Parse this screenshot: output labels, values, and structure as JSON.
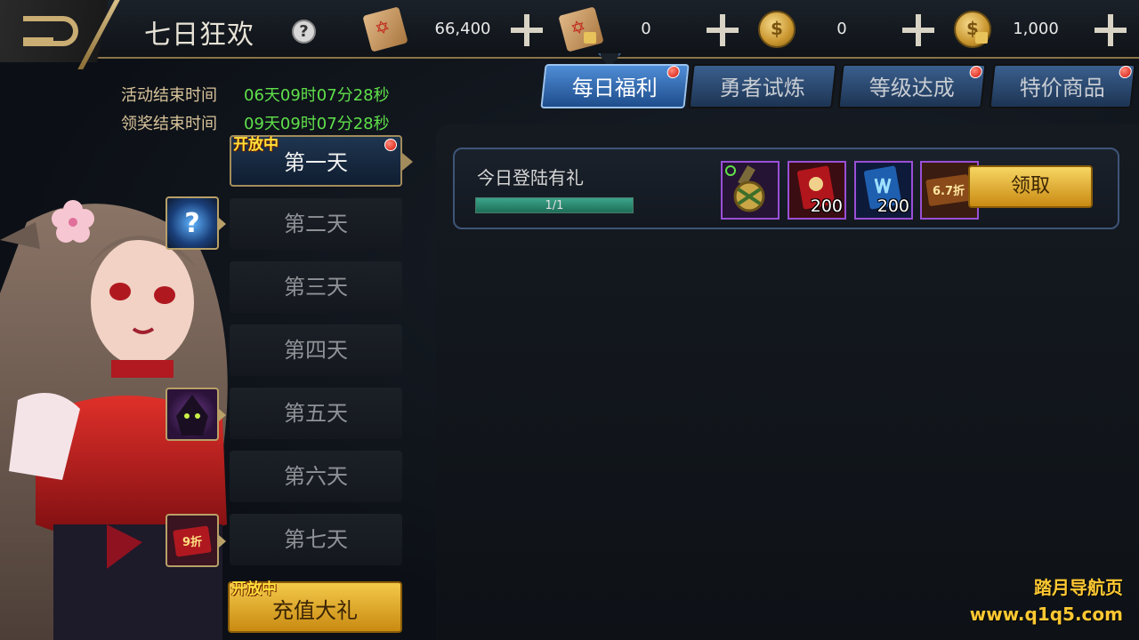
{
  "header": {
    "title": "七日狂欢",
    "help_icon": "question-mark-icon",
    "resources": [
      {
        "name": "scroll",
        "icon": "red-seal-scroll-icon",
        "value": "66,400"
      },
      {
        "name": "locked-scroll",
        "icon": "locked-seal-scroll-icon",
        "value": "0"
      },
      {
        "name": "coin",
        "icon": "gold-coin-icon",
        "value": "0"
      },
      {
        "name": "locked-coin",
        "icon": "locked-gold-coin-icon",
        "value": "1,000"
      }
    ]
  },
  "timers": {
    "activity_label": "活动结束时间",
    "activity_value": "06天09时07分28秒",
    "claim_label": "领奖结束时间",
    "claim_value": "09天09时07分28秒"
  },
  "days": [
    {
      "label": "第一天",
      "active": true,
      "open_tag": "开放中"
    },
    {
      "label": "第二天",
      "icon": "mystery-orb-icon"
    },
    {
      "label": "第三天"
    },
    {
      "label": "第四天"
    },
    {
      "label": "第五天",
      "icon": "hooded-figure-icon"
    },
    {
      "label": "第六天"
    },
    {
      "label": "第七天",
      "icon": "discount-ticket-icon",
      "icon_text": "9折"
    }
  ],
  "recharge": {
    "label": "充值大礼",
    "open_tag": "开放中"
  },
  "tabs": [
    {
      "label": "每日福利",
      "active": true
    },
    {
      "label": "勇者试炼"
    },
    {
      "label": "等级达成"
    },
    {
      "label": "特价商品"
    }
  ],
  "reward": {
    "title": "今日登陆有礼",
    "progress_text": "1/1",
    "progress": 1.0,
    "items": [
      {
        "icon": "medal-icon",
        "qty": ""
      },
      {
        "icon": "red-scroll-icon",
        "qty": "200"
      },
      {
        "icon": "blue-scroll-icon",
        "qty": "200"
      },
      {
        "icon": "discount-ticket-icon",
        "qty": "",
        "label": "6.7折"
      }
    ],
    "claim_label": "领取"
  },
  "watermark": {
    "line1": "踏月导航页",
    "line2": "www.q1q5.com"
  },
  "colors": {
    "gold": "#c9ad72",
    "green_timer": "#5fe04a",
    "tab_blue": "#3a5f8e",
    "rarity_purple": "#9a4fd6"
  }
}
